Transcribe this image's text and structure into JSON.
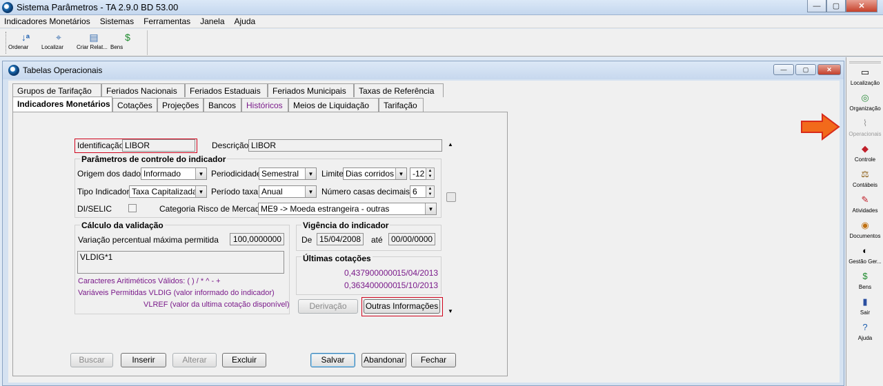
{
  "window": {
    "title": "Sistema Parâmetros -  TA 2.9.0 BD 53.00",
    "controls": {
      "minimize": "—",
      "maximize": "▢",
      "close": "✕"
    }
  },
  "menu": [
    "Indicadores Monetários",
    "Sistemas",
    "Ferramentas",
    "Janela",
    "Ajuda"
  ],
  "toolbar": [
    {
      "label": "Ordenar",
      "icon": "sort-icon"
    },
    {
      "label": "Localizar",
      "icon": "find-icon"
    },
    {
      "label": "Criar Relat...",
      "icon": "report-icon"
    },
    {
      "label": "Bens",
      "icon": "money-bag-icon"
    }
  ],
  "inner_window": {
    "title": "Tabelas Operacionais"
  },
  "tabs_row1": [
    "Grupos de Tarifação",
    "Feriados Nacionais",
    "Feriados Estaduais",
    "Feriados Municipais",
    "Taxas de Referência"
  ],
  "tabs_row2": [
    "Indicadores Monetários",
    "Cotações",
    "Projeções",
    "Bancos",
    "Históricos",
    "Meios de Liquidação",
    "Tarifação"
  ],
  "form": {
    "identificacao_label": "Identificação",
    "identificacao_value": "LIBOR",
    "descricao_label": "Descrição",
    "descricao_value": "LIBOR",
    "params_title": "Parâmetros de controle do indicador",
    "origem_label": "Origem dos dados",
    "origem_value": "Informado",
    "periodicidade_label": "Periodicidade",
    "periodicidade_value": "Semestral",
    "limite_label": "Limite",
    "limite_value": "Dias corridos",
    "limite_num": "-12",
    "tipo_label": "Tipo Indicador",
    "tipo_value": "Taxa Capitalizada",
    "periodo_label": "Período taxa",
    "periodo_value": "Anual",
    "casas_label": "Número casas decimais",
    "casas_value": "6",
    "diselic_label": "DI/SELIC",
    "categoria_label": "Categoria Risco de Mercado",
    "categoria_value": "ME9 -> Moeda estrangeira - outras",
    "calculo_title": "Cálculo da validação",
    "variacao_label": "Variação percentual máxima permitida",
    "variacao_value": "100,0000000",
    "formula_value": "VLDIG*1",
    "caracteres_text": "Caracteres Aritiméticos Válidos:    ( ) / * ^ - +",
    "variaveis_text": "Variáveis Permitidas VLDIG  (valor informado do indicador)",
    "vlref_text": "VLREF (valor da ultima cotação disponível)",
    "vigencia_title": "Vigência do indicador",
    "de_label": "De",
    "de_value": "15/04/2008",
    "ate_label": "até",
    "ate_value": "00/00/0000",
    "ultimas_title": "Últimas cotações",
    "cotacoes": [
      {
        "valor": "0,4379000000",
        "data": "15/04/2013"
      },
      {
        "valor": "0,3634000000",
        "data": "15/10/2013"
      }
    ],
    "derivacao_button": "Derivação",
    "outras_button": "Outras Informações"
  },
  "bottom_buttons": {
    "buscar": "Buscar",
    "inserir": "Inserir",
    "alterar": "Alterar",
    "excluir": "Excluir",
    "salvar": "Salvar",
    "abandonar": "Abandonar",
    "fechar": "Fechar"
  },
  "sidebar": [
    {
      "label": "Localização",
      "icon": "location-icon",
      "enabled": true
    },
    {
      "label": "Organização",
      "icon": "organization-icon",
      "enabled": true
    },
    {
      "label": "Operacionais",
      "icon": "handshake-icon",
      "enabled": false
    },
    {
      "label": "Controle",
      "icon": "control-icon",
      "enabled": true
    },
    {
      "label": "Contábeis",
      "icon": "scales-icon",
      "enabled": true
    },
    {
      "label": "Atividades",
      "icon": "activities-icon",
      "enabled": true
    },
    {
      "label": "Documentos",
      "icon": "documents-icon",
      "enabled": true
    },
    {
      "label": "Gestão Ger...",
      "icon": "management-icon",
      "enabled": true
    },
    {
      "label": "Bens",
      "icon": "money-bag-icon",
      "enabled": true
    },
    {
      "label": "Sair",
      "icon": "exit-icon",
      "enabled": true
    },
    {
      "label": "Ajuda",
      "icon": "help-icon",
      "enabled": true
    }
  ],
  "colors": {
    "accent_purple": "#7a1a8a",
    "highlight_red": "#d0021b",
    "arrow_orange": "#f26a1b"
  }
}
